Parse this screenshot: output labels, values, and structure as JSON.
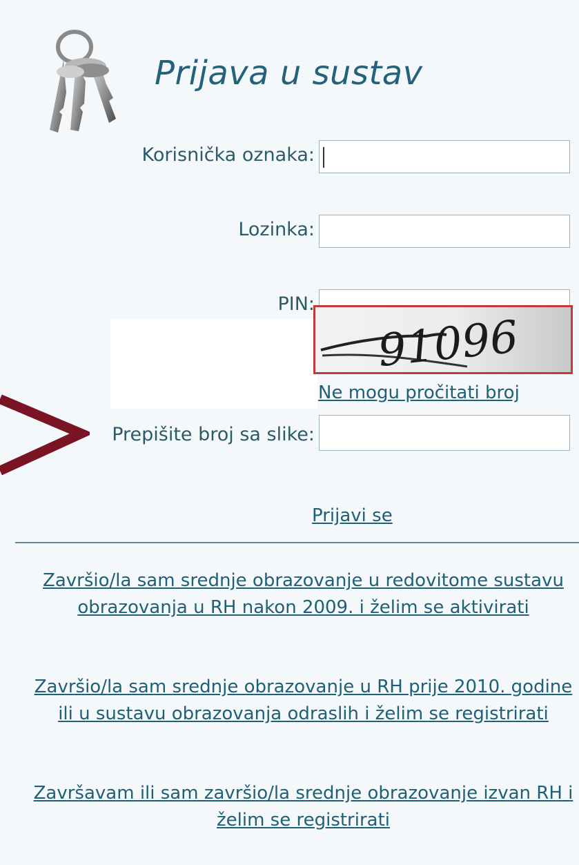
{
  "title": "Prijava u sustav",
  "form": {
    "username_label": "Korisnička oznaka:",
    "username_value": "",
    "password_label": "Lozinka:",
    "password_value": "",
    "pin_label": "PIN:",
    "pin_value": "",
    "captcha_text": "91096",
    "captcha_link": "Ne mogu pročitati broj",
    "captcha_label": "Prepišite broj sa slike:",
    "captcha_value": ""
  },
  "login_link": "Prijavi se",
  "links": [
    "Završio/la sam srednje obrazovanje u redovitome sustavu obrazovanja u RH nakon 2009. i želim se aktivirati",
    "Završio/la sam srednje obrazovanje u RH prije 2010. godine ili u sustavu obrazovanja odraslih i želim se registrirati",
    "Završavam ili sam završio/la srednje obrazovanje izvan RH i želim se registrirati"
  ],
  "colors": {
    "background": "#f4f8fb",
    "title": "#24627a",
    "link": "#1f6075",
    "captcha_border": "#c43a3a",
    "arrow": "#7a1424"
  },
  "icons": [
    "keys-icon",
    "arrow-pointer-icon"
  ]
}
